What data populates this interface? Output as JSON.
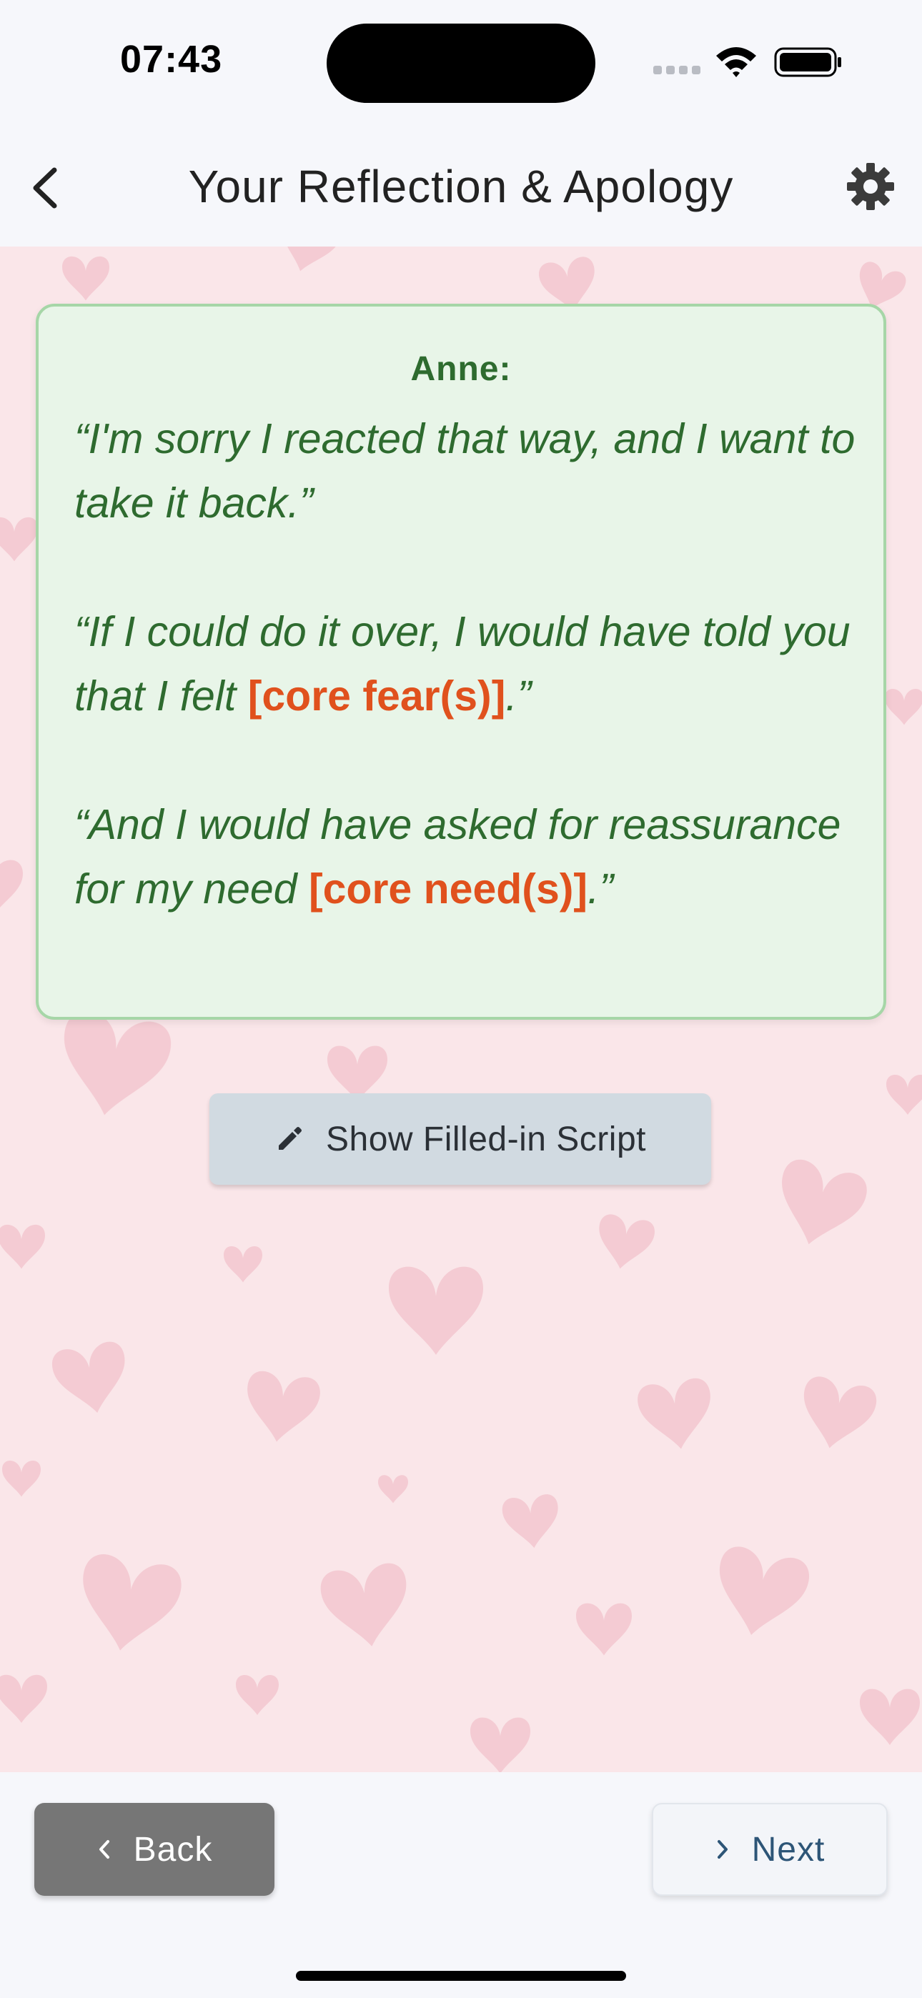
{
  "status_bar": {
    "time": "07:43"
  },
  "header": {
    "title": "Your Reflection & Apology"
  },
  "card": {
    "speaker": "Anne:",
    "line1": "“I'm sorry I reacted that way, and I want to take it back.”",
    "line2_prefix": "“If I could do it over, I would have told you that I felt ",
    "line2_placeholder": "[core fear(s)]",
    "line2_suffix": ".”",
    "line3_prefix": "“And I would have asked for reassurance for my need ",
    "line3_placeholder": "[core need(s)]",
    "line3_suffix": ".”"
  },
  "show_script_button": {
    "label": "Show Filled-in Script",
    "icon": "pencil-icon"
  },
  "footer": {
    "back_label": "Back",
    "next_label": "Next"
  },
  "colors": {
    "card_text": "#2e6b2f",
    "placeholder": "#e0511d",
    "background": "#fae6e9",
    "heart": "#f2c2cb",
    "back_button": "#767676",
    "next_text": "#2d5577"
  }
}
